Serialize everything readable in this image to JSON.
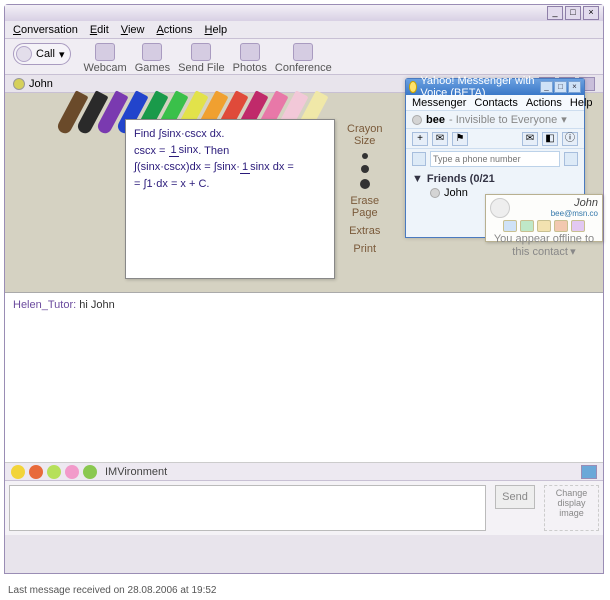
{
  "main": {
    "menu": {
      "conversation": "Conversation",
      "edit": "Edit",
      "view": "View",
      "actions": "Actions",
      "help": "Help"
    },
    "tool": {
      "call": "Call",
      "webcam": "Webcam",
      "games": "Games",
      "sendfile": "Send File",
      "photos": "Photos",
      "conference": "Conference"
    },
    "to": "John",
    "whiteboard": {
      "l1a": "Find ",
      "l1b": "∫sinx·cscx dx.",
      "l2a": "cscx = ",
      "l2n": "1",
      "l2d": "sinx",
      "l2b": ".   Then",
      "l3a": "∫(sinx·cscx)dx = ∫sinx·",
      "l3n": "1",
      "l3d": "sinx",
      "l3b": " dx =",
      "l4": "= ∫1·dx = x + C."
    },
    "tools": {
      "crayon": "Crayon",
      "size": "Size",
      "erase": "Erase",
      "page": "Page",
      "extras": "Extras",
      "print": "Print"
    },
    "chat": {
      "sender": "Helen_Tutor:",
      "msg": " hi John"
    },
    "imv": "IMVironment",
    "send": "Send",
    "change": "Change display image",
    "status": "Last message received on 28.08.2006 at 19:52"
  },
  "ym": {
    "title": "Yahoo! Messenger with Voice (BETA)",
    "menu": {
      "m": "Messenger",
      "c": "Contacts",
      "a": "Actions",
      "h": "Help"
    },
    "user": "bee",
    "ustat": "- Invisible to Everyone",
    "arrow": "▾",
    "phone_ph": "Type a phone number",
    "group": "Friends (0/21",
    "tri": "▼",
    "plus": "+",
    "contact": "John"
  },
  "pop": {
    "name": "John",
    "mail": "bee@msn.co",
    "foot": "You appear offline to this contact",
    "arrow": "▾"
  },
  "crayons": [
    "#6a4a2a",
    "#2a2a2a",
    "#7a3ab0",
    "#2244cc",
    "#1a9a4a",
    "#3ac04a",
    "#e2e24a",
    "#f0a030",
    "#e04a3a",
    "#c02a6a",
    "#e878a8",
    "#f2c8d8",
    "#f0e8a8"
  ]
}
